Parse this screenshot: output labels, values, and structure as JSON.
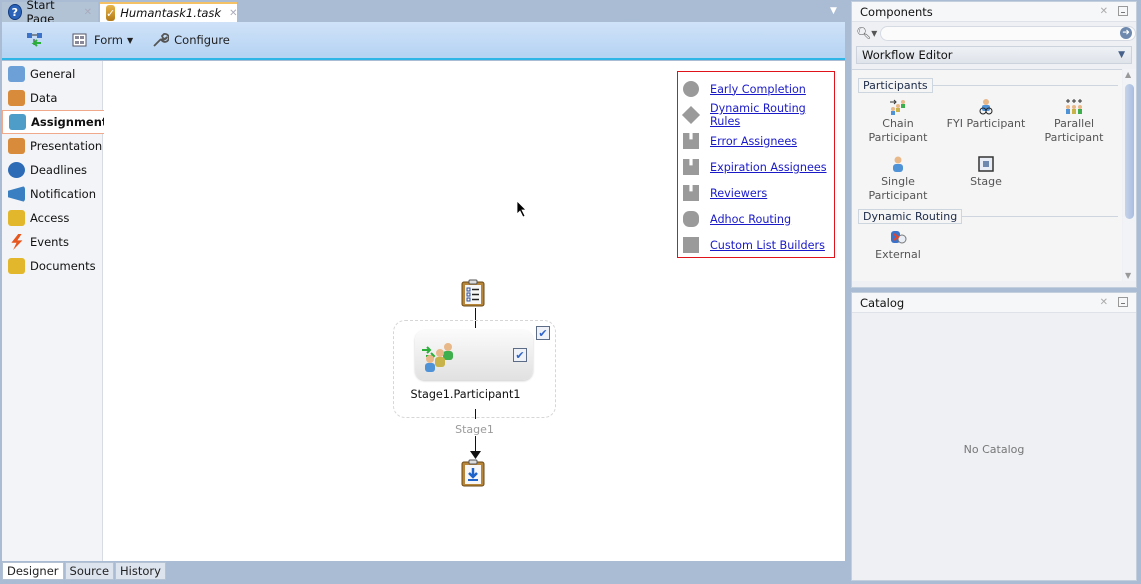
{
  "editor": {
    "tabs": [
      {
        "label": "Start Page",
        "icon": "help-icon",
        "active": false
      },
      {
        "label": "Humantask1.task",
        "icon": "task-icon",
        "active": true
      }
    ],
    "toolbar": {
      "form_label": "Form",
      "configure_label": "Configure"
    },
    "sidebar": {
      "items": [
        {
          "label": "General",
          "icon": "general-icon",
          "color": "#6ea0d8"
        },
        {
          "label": "Data",
          "icon": "data-icon",
          "color": "#d88b3a"
        },
        {
          "label": "Assignment",
          "icon": "assignment-icon",
          "color": "#4e9cc8",
          "selected": true
        },
        {
          "label": "Presentation",
          "icon": "presentation-icon",
          "color": "#d88b3a"
        },
        {
          "label": "Deadlines",
          "icon": "deadlines-icon",
          "color": "#2d6bb6"
        },
        {
          "label": "Notification",
          "icon": "notification-icon",
          "color": "#3a7fc2"
        },
        {
          "label": "Access",
          "icon": "access-icon",
          "color": "#e3b72b"
        },
        {
          "label": "Events",
          "icon": "events-icon",
          "color": "#e6561e"
        },
        {
          "label": "Documents",
          "icon": "documents-icon",
          "color": "#e3b72b"
        }
      ]
    },
    "links": [
      {
        "label": "Early Completion",
        "icon": "clock-icon"
      },
      {
        "label": "Dynamic Routing Rules",
        "icon": "diamond-icon"
      },
      {
        "label": "Error Assignees",
        "icon": "assignees-icon"
      },
      {
        "label": "Expiration Assignees",
        "icon": "assignees-icon"
      },
      {
        "label": "Reviewers",
        "icon": "assignees-icon"
      },
      {
        "label": "Adhoc Routing",
        "icon": "adhoc-icon"
      },
      {
        "label": "Custom List Builders",
        "icon": "list-builder-icon"
      }
    ],
    "flow": {
      "participant_label": "Stage1.Participant1",
      "stage_label": "Stage1",
      "stage_checked": true,
      "participant_checked": true
    },
    "bottom_tabs": [
      {
        "label": "Designer",
        "selected": true
      },
      {
        "label": "Source",
        "selected": false
      },
      {
        "label": "History",
        "selected": false
      }
    ],
    "link_border_color": "#e0121a",
    "link_color": "#1a1ac8"
  },
  "components": {
    "title": "Components",
    "search_placeholder": "",
    "dropdown_value": "Workflow Editor",
    "groups": [
      {
        "label": "Participants",
        "items": [
          {
            "label": "Chain Participant",
            "icon": "chain-participant-icon"
          },
          {
            "label": "FYI Participant",
            "icon": "fyi-participant-icon"
          },
          {
            "label": "Parallel Participant",
            "icon": "parallel-participant-icon"
          },
          {
            "label": "Single Participant",
            "icon": "single-participant-icon"
          },
          {
            "label": "Stage",
            "icon": "stage-icon"
          }
        ]
      },
      {
        "label": "Dynamic Routing",
        "items": [
          {
            "label": "External",
            "icon": "external-icon"
          }
        ]
      }
    ]
  },
  "catalog": {
    "title": "Catalog",
    "empty_text": "No Catalog"
  }
}
